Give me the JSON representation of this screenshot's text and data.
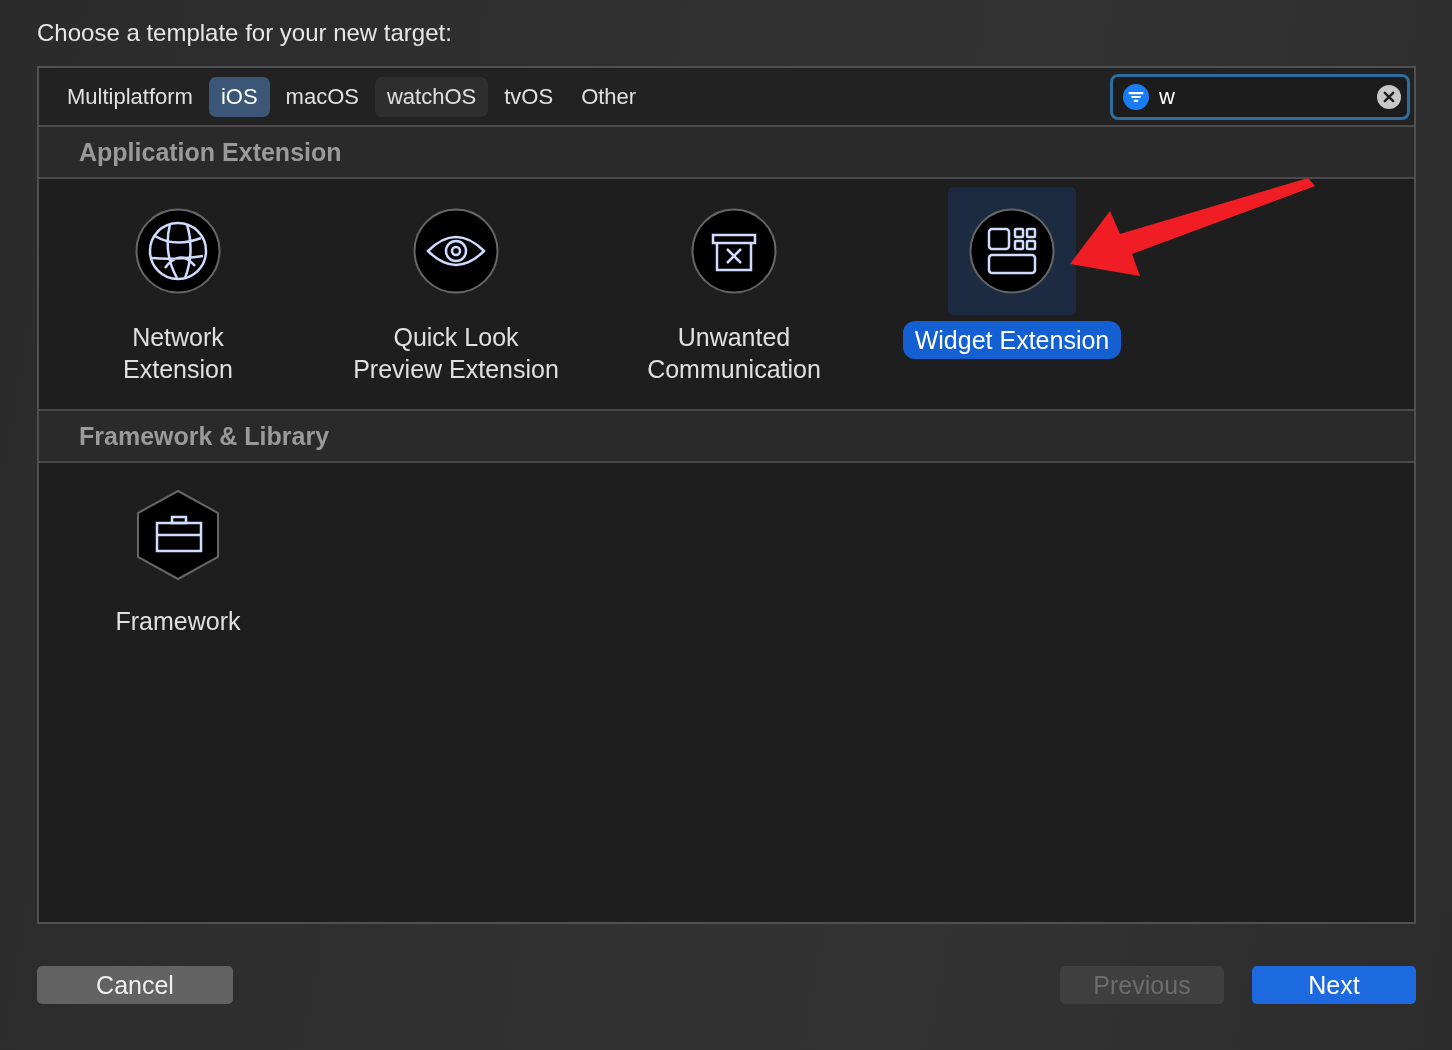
{
  "heading": "Choose a template for your new target:",
  "tabs": [
    {
      "label": "Multiplatform",
      "selected": false,
      "hovered": false
    },
    {
      "label": "iOS",
      "selected": true,
      "hovered": false
    },
    {
      "label": "macOS",
      "selected": false,
      "hovered": false
    },
    {
      "label": "watchOS",
      "selected": false,
      "hovered": true
    },
    {
      "label": "tvOS",
      "selected": false,
      "hovered": false
    },
    {
      "label": "Other",
      "selected": false,
      "hovered": false
    }
  ],
  "search": {
    "value": "w"
  },
  "sections": [
    {
      "title": "Application Extension",
      "templates": [
        {
          "label": "Network\nExtension",
          "kind": "network",
          "selected": false
        },
        {
          "label": "Quick Look\nPreview Extension",
          "kind": "preview",
          "selected": false
        },
        {
          "label": "Unwanted\nCommunication",
          "kind": "filter",
          "selected": false
        },
        {
          "label": "Widget Extension",
          "kind": "widget",
          "selected": true
        }
      ]
    },
    {
      "title": "Framework & Library",
      "templates": [
        {
          "label": "Framework",
          "kind": "framework",
          "selected": false
        }
      ]
    }
  ],
  "buttons": [
    {
      "label": "Cancel",
      "kind": "normal",
      "disabled": false
    },
    {
      "label": "Previous",
      "kind": "normal",
      "disabled": true
    },
    {
      "label": "Next",
      "kind": "default",
      "disabled": false
    }
  ]
}
